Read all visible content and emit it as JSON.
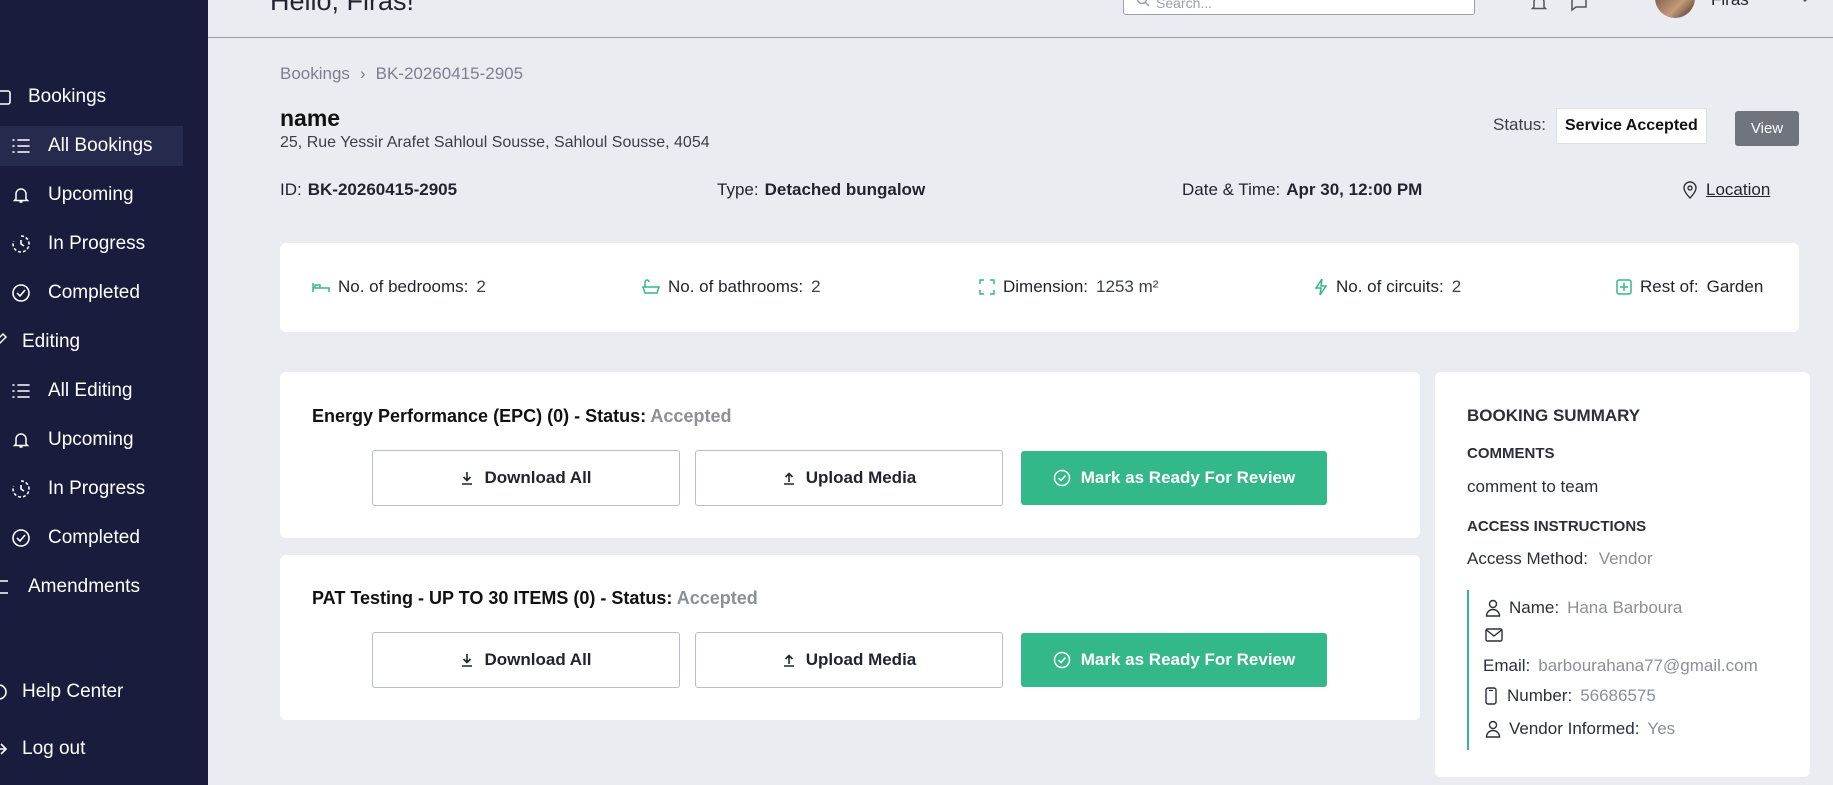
{
  "header": {
    "greeting": "Hello, Firas!",
    "search_placeholder": "Search...",
    "user_name": "Firas"
  },
  "sidebar": {
    "sections": [
      {
        "label": "Bookings"
      },
      {
        "label": "Editing"
      },
      {
        "label": "Amendments"
      }
    ],
    "items": [
      {
        "label": "All Bookings",
        "icon": "list-icon"
      },
      {
        "label": "Upcoming",
        "icon": "bell-icon"
      },
      {
        "label": "In Progress",
        "icon": "clock-icon"
      },
      {
        "label": "Completed",
        "icon": "check-circle-icon"
      },
      {
        "label": "All Editing",
        "icon": "list-icon"
      },
      {
        "label": "Upcoming",
        "icon": "bell-icon"
      },
      {
        "label": "In Progress",
        "icon": "clock-icon"
      },
      {
        "label": "Completed",
        "icon": "check-circle-icon"
      }
    ],
    "help": "Help Center",
    "logout": "Log out"
  },
  "breadcrumb": {
    "root": "Bookings",
    "sep": "›",
    "current": "BK-20260415-2905"
  },
  "booking": {
    "name": "name",
    "address": "25, Rue Yessir Arafet Sahloul Sousse, Sahloul Sousse, 4054",
    "status_label": "Status:",
    "status_value": "Service Accepted",
    "view_label": "View",
    "id_label": "ID:",
    "id_value": "BK-20260415-2905",
    "type_label": "Type:",
    "type_value": "Detached bungalow",
    "datetime_label": "Date & Time:",
    "datetime_value": "Apr 30, 12:00 PM",
    "location_label": "Location"
  },
  "properties": [
    {
      "label": "No. of bedrooms:",
      "value": "2",
      "icon": "bed-icon"
    },
    {
      "label": "No. of bathrooms:",
      "value": "2",
      "icon": "bathtub-icon"
    },
    {
      "label": "Dimension:",
      "value": "1253 m²",
      "icon": "expand-icon"
    },
    {
      "label": "No. of circuits:",
      "value": "2",
      "icon": "lightning-icon"
    },
    {
      "label": "Rest of:",
      "value": "Garden",
      "icon": "plus-square-icon"
    }
  ],
  "services": [
    {
      "title": "Energy Performance (EPC) (0) - Status:",
      "status": "Accepted",
      "download": "Download All",
      "upload": "Upload Media",
      "ready": "Mark as Ready For Review"
    },
    {
      "title": "PAT Testing - UP TO 30 ITEMS (0) - Status:",
      "status": "Accepted",
      "download": "Download All",
      "upload": "Upload Media",
      "ready": "Mark as Ready For Review"
    }
  ],
  "summary": {
    "heading": "BOOKING SUMMARY",
    "comments_heading": "COMMENTS",
    "comments": "comment to team",
    "access_heading": "ACCESS INSTRUCTIONS",
    "access_method_label": "Access Method:",
    "access_method_value": "Vendor",
    "name_label": "Name:",
    "name_value": "Hana Barboura",
    "email_label": "Email:",
    "email_value": "barbourahana77@gmail.com",
    "number_label": "Number:",
    "number_value": "56686575",
    "informed_label": "Vendor Informed:",
    "informed_value": "Yes"
  },
  "colors": {
    "sidebar_bg": "#191c3d",
    "accent_green": "#33b889",
    "page_bg": "#e9edf2"
  }
}
